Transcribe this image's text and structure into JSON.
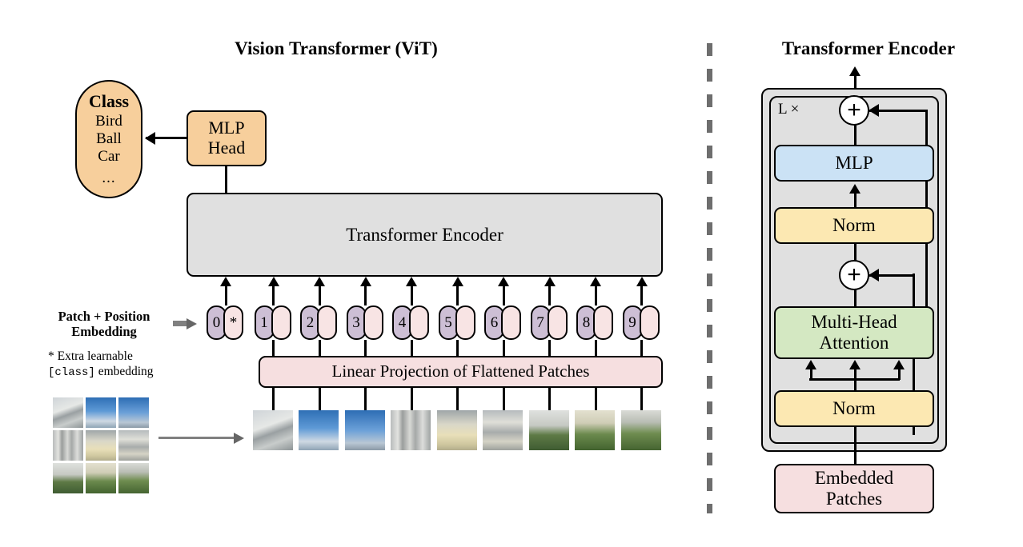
{
  "figure": {
    "left_title": "Vision Transformer (ViT)",
    "right_title": "Transformer Encoder"
  },
  "colors": {
    "orange": "#f7cf9c",
    "gray_box": "#e0e0e0",
    "pink": "#f6dfe0",
    "token_pink": "#f8e4e4",
    "token_purple": "#cdbfd5",
    "blue": "#cbe2f5",
    "yellow": "#fce8b2",
    "green": "#d4e8c2",
    "divider_gray": "#6e6e6e",
    "arrow_gray": "#808080",
    "stroke": "#000000"
  },
  "left": {
    "class_box": {
      "header": "Class",
      "items": [
        "Bird",
        "Ball",
        "Car"
      ],
      "ellipsis": "..."
    },
    "mlp_head": {
      "line1": "MLP",
      "line2": "Head"
    },
    "encoder_box": {
      "label": "Transformer Encoder"
    },
    "linear_projection": {
      "label": "Linear Projection of Flattened Patches"
    },
    "embedding_label": {
      "line1": "Patch + Position",
      "line2": "Embedding"
    },
    "footnote": {
      "line1": "* Extra learnable",
      "mono": "[class]",
      "line2_tail": " embedding"
    },
    "tokens": [
      {
        "number": "0",
        "star": "*"
      },
      {
        "number": "1",
        "star": ""
      },
      {
        "number": "2",
        "star": ""
      },
      {
        "number": "3",
        "star": ""
      },
      {
        "number": "4",
        "star": ""
      },
      {
        "number": "5",
        "star": ""
      },
      {
        "number": "6",
        "star": ""
      },
      {
        "number": "7",
        "star": ""
      },
      {
        "number": "8",
        "star": ""
      },
      {
        "number": "9",
        "star": ""
      }
    ]
  },
  "right": {
    "repeat_label": "L ×",
    "mlp": {
      "label": "MLP"
    },
    "norm_top": {
      "label": "Norm"
    },
    "attention": {
      "line1": "Multi-Head",
      "line2": "Attention"
    },
    "norm_bottom": {
      "label": "Norm"
    },
    "embedded_patches": {
      "line1": "Embedded",
      "line2": "Patches"
    },
    "residual_add_top": {
      "symbol": "+"
    },
    "residual_add_bottom": {
      "symbol": "+"
    }
  }
}
